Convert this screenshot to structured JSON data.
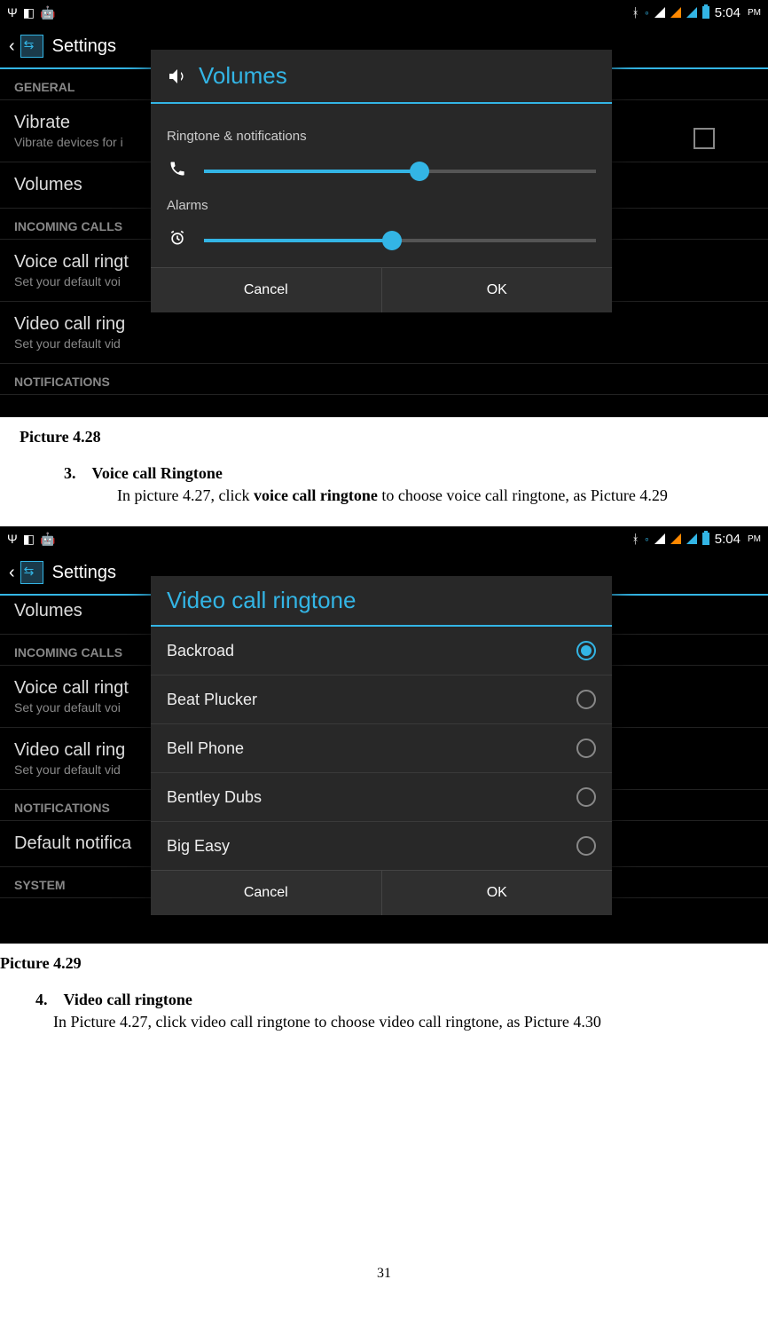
{
  "statusbar": {
    "time": "5:04",
    "ampm": "PM"
  },
  "settings_title": "Settings",
  "screenshot1": {
    "sections": {
      "general": "GENERAL",
      "incoming": "INCOMING CALLS",
      "notifications": "NOTIFICATIONS"
    },
    "items": {
      "vibrate_title": "Vibrate",
      "vibrate_sub": "Vibrate devices for i",
      "volumes_title": "Volumes",
      "voice_title": "Voice call ringt",
      "voice_sub": "Set your default voi",
      "video_title": "Video call ring",
      "video_sub": "Set your default vid"
    },
    "dialog": {
      "title": "Volumes",
      "label1": "Ringtone & notifications",
      "label2": "Alarms",
      "slider1_pct": 55,
      "slider2_pct": 48,
      "cancel": "Cancel",
      "ok": "OK"
    }
  },
  "caption1": "Picture 4.28",
  "section3": {
    "num": "3.",
    "title": "Voice call Ringtone",
    "body_a": "In picture 4.27, click ",
    "body_bold": "voice call ringtone",
    "body_b": " to choose voice call ringtone, as Picture 4.29"
  },
  "screenshot2": {
    "sections": {
      "incoming": "INCOMING CALLS",
      "notifications": "NOTIFICATIONS",
      "system": "SYSTEM"
    },
    "items": {
      "volumes_title": "Volumes",
      "voice_title": "Voice call ringt",
      "voice_sub": "Set your default voi",
      "video_title": "Video call ring",
      "video_sub": "Set your default vid",
      "default_notif": "Default notifica"
    },
    "dialog": {
      "title": "Video call ringtone",
      "options": [
        "Backroad",
        "Beat Plucker",
        "Bell Phone",
        "Bentley Dubs",
        "Big Easy"
      ],
      "selected_index": 0,
      "cancel": "Cancel",
      "ok": "OK"
    }
  },
  "caption2": "Picture 4.29",
  "section4": {
    "num": "4.",
    "title": "Video call ringtone",
    "body": "In Picture 4.27, click video call ringtone to choose video call ringtone, as Picture 4.30"
  },
  "pagenum": "31"
}
